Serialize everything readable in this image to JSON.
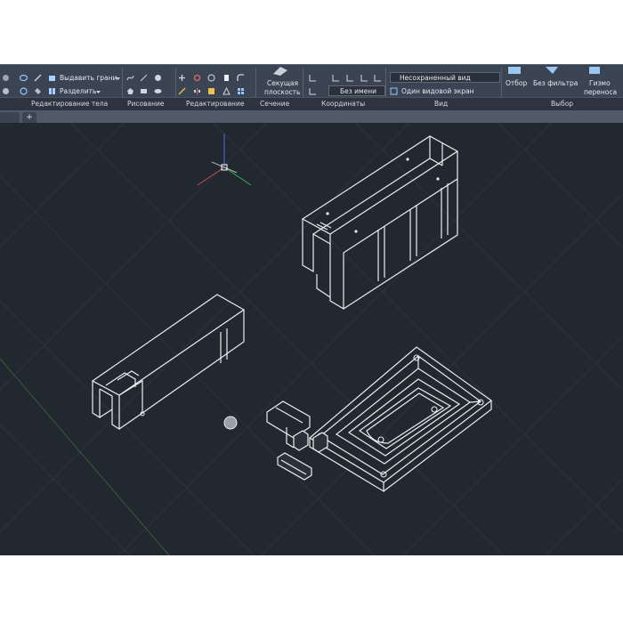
{
  "ribbon": {
    "solid_edit": {
      "extrude_faces": "Выдавить грани",
      "separate": "Разделить"
    },
    "section": {
      "label_line1": "Секущая",
      "label_line2": "плоскость"
    },
    "coordinates": {
      "ucs_named": "Без имени"
    },
    "view": {
      "saved_view": "Несохраненный вид",
      "viewport_config": "Один видовой экран"
    },
    "selection": {
      "culling": "Отбор",
      "filter": "Без фильтра",
      "gizmo_line1": "Гизмо",
      "gizmo_line2": "переноса"
    }
  },
  "panels": [
    "Редактирование тела",
    "Рисование",
    "Редактирование",
    "Сечение",
    "Координаты",
    "Вид",
    "Выбор"
  ],
  "file_tab_plus": "+",
  "colors": {
    "viewport_bg": "#212830",
    "ribbon_bg": "#3b4453",
    "model_edge": "#e8e8e8"
  },
  "icons": [
    "ucs-icon",
    "view-cube"
  ]
}
